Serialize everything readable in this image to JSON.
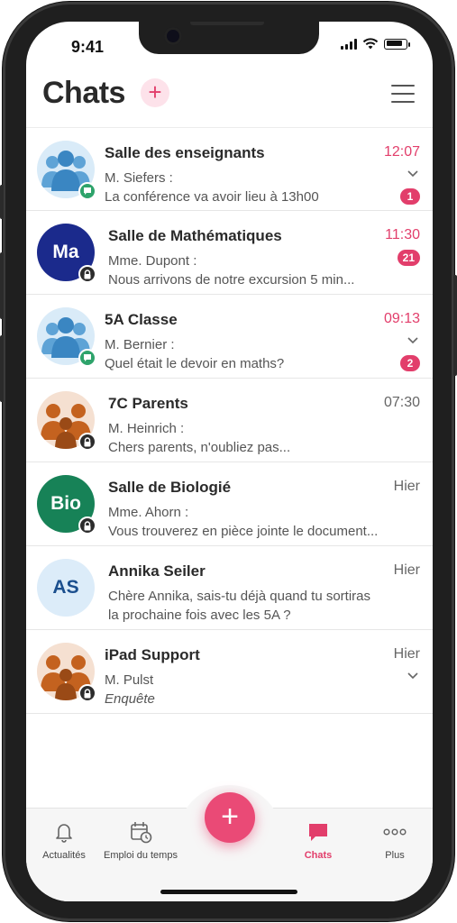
{
  "status_bar": {
    "time": "9:41"
  },
  "header": {
    "title": "Chats",
    "add_label": "+"
  },
  "chats": [
    {
      "title": "Salle des enseignants",
      "sender": "M. Siefers :",
      "preview": "La conférence va avoir lieu à 13h00",
      "time": "12:07",
      "unread": "1",
      "avatar_type": "group",
      "badge": "chat"
    },
    {
      "title": "Salle de Mathématiques",
      "sender": "Mme. Dupont :",
      "preview": "Nous arrivons de notre excursion 5 min...",
      "time": "11:30",
      "unread": "21",
      "avatar_text": "Ma",
      "badge": "lock"
    },
    {
      "title": "5A Classe",
      "sender": "M. Bernier :",
      "preview": "Quel était le devoir en maths?",
      "time": "09:13",
      "unread": "2",
      "avatar_type": "group",
      "badge": "chat"
    },
    {
      "title": "7C Parents",
      "sender": "M. Heinrich :",
      "preview": "Chers parents, n'oubliez pas...",
      "time": "07:30",
      "avatar_type": "parents",
      "badge": "lock"
    },
    {
      "title": "Salle de Biologié",
      "sender": "Mme. Ahorn :",
      "preview": "Vous trouverez en pièce jointe le document...",
      "time": "Hier",
      "avatar_text": "Bio",
      "badge": "lock"
    },
    {
      "title": "Annika Seiler",
      "preview_line1": "Chère Annika, sais-tu déjà quand tu sortiras",
      "preview_line2": "la prochaine fois avec les 5A ?",
      "time": "Hier",
      "avatar_text": "AS"
    },
    {
      "title": "iPad Support",
      "sender": "M. Pulst",
      "preview": "Enquête",
      "time": "Hier",
      "avatar_type": "parents",
      "badge": "lock"
    }
  ],
  "tabbar": {
    "tabs": [
      {
        "label": "Actualités",
        "icon": "bell-icon"
      },
      {
        "label": "Emploi du temps",
        "icon": "calendar-clock-icon"
      },
      {
        "label": "Chats",
        "icon": "chat-bubble-icon",
        "active": true
      },
      {
        "label": "Plus",
        "icon": "more-dots-icon"
      }
    ],
    "fab_label": "+"
  },
  "colors": {
    "accent": "#e23e6b",
    "navy_avatar": "#1b2a8c",
    "green_avatar": "#178257",
    "group_avatar": "#4a90c8",
    "parents_avatar": "#b5541a"
  }
}
